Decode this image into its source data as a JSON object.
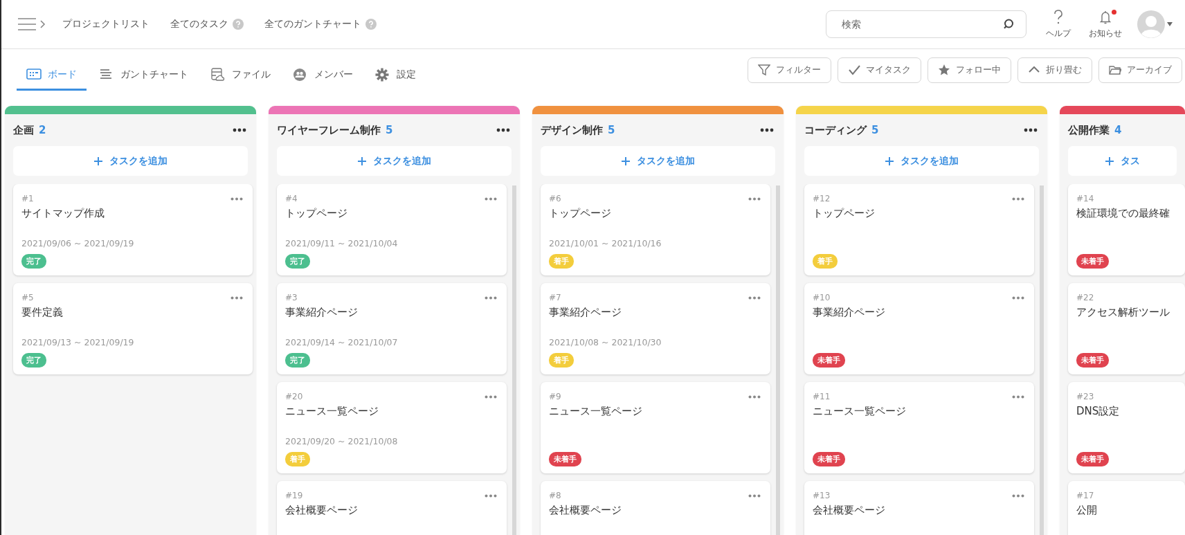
{
  "topbar": {
    "links": [
      {
        "label": "プロジェクトリスト",
        "help": false
      },
      {
        "label": "全てのタスク",
        "help": true
      },
      {
        "label": "全てのガントチャート",
        "help": true
      }
    ],
    "search": {
      "placeholder": "検索"
    },
    "help": {
      "label": "ヘルプ"
    },
    "notifications": {
      "label": "お知らせ",
      "unread": true
    }
  },
  "tabs": [
    {
      "label": "ボード",
      "selected": true
    },
    {
      "label": "ガントチャート",
      "selected": false
    },
    {
      "label": "ファイル",
      "selected": false
    },
    {
      "label": "メンバー",
      "selected": false
    },
    {
      "label": "設定",
      "selected": false
    }
  ],
  "actions": [
    "フィルター",
    "マイタスク",
    "フォロー中",
    "折り畳む",
    "アーカイブ"
  ],
  "columns": [
    {
      "title": "企画",
      "count": "2",
      "color": "#52c08e",
      "menu": true,
      "add_label": "タスクを追加",
      "cards": [
        {
          "id": "#1",
          "title": "サイトマップ作成",
          "dates": "2021/09/06 ~ 2021/09/19",
          "status": {
            "label": "完了",
            "color": "#4cbf8f"
          }
        },
        {
          "id": "#5",
          "title": "要件定義",
          "dates": "2021/09/13 ~ 2021/09/19",
          "status": {
            "label": "完了",
            "color": "#4cbf8f"
          }
        }
      ]
    },
    {
      "title": "ワイヤーフレーム制作",
      "count": "5",
      "color": "#ec74b5",
      "menu": true,
      "add_label": "タスクを追加",
      "cards": [
        {
          "id": "#4",
          "title": "トップページ",
          "dates": "2021/09/11 ~ 2021/10/04",
          "status": {
            "label": "完了",
            "color": "#4cbf8f"
          }
        },
        {
          "id": "#3",
          "title": "事業紹介ページ",
          "dates": "2021/09/14 ~ 2021/10/07",
          "status": {
            "label": "完了",
            "color": "#4cbf8f"
          }
        },
        {
          "id": "#20",
          "title": "ニュース一覧ページ",
          "dates": "2021/09/20 ~ 2021/10/08",
          "status": {
            "label": "着手",
            "color": "#f3cd3c"
          }
        },
        {
          "id": "#19",
          "title": "会社概要ページ"
        }
      ]
    },
    {
      "title": "デザイン制作",
      "count": "5",
      "color": "#f0913f",
      "menu": true,
      "add_label": "タスクを追加",
      "cards": [
        {
          "id": "#6",
          "title": "トップページ",
          "dates": "2021/10/01 ~ 2021/10/16",
          "status": {
            "label": "着手",
            "color": "#f3cd3c"
          }
        },
        {
          "id": "#7",
          "title": "事業紹介ページ",
          "dates": "2021/10/08 ~ 2021/10/30",
          "status": {
            "label": "着手",
            "color": "#f3cd3c"
          }
        },
        {
          "id": "#9",
          "title": "ニュース一覧ページ",
          "status": {
            "label": "未着手",
            "color": "#e0434f"
          }
        },
        {
          "id": "#8",
          "title": "会社概要ページ"
        }
      ]
    },
    {
      "title": "コーディング",
      "count": "5",
      "color": "#f5d44a",
      "menu": true,
      "add_label": "タスクを追加",
      "cards": [
        {
          "id": "#12",
          "title": "トップページ",
          "status": {
            "label": "着手",
            "color": "#f3cd3c"
          }
        },
        {
          "id": "#10",
          "title": "事業紹介ページ",
          "status": {
            "label": "未着手",
            "color": "#e0434f"
          }
        },
        {
          "id": "#11",
          "title": "ニュース一覧ページ",
          "status": {
            "label": "未着手",
            "color": "#e0434f"
          }
        },
        {
          "id": "#13",
          "title": "会社概要ページ"
        }
      ]
    },
    {
      "title": "公開作業",
      "count": "4",
      "color": "#e5485a",
      "menu": false,
      "add_label": "タス",
      "cards": [
        {
          "id": "#14",
          "title": "検証環境での最終確",
          "status": {
            "label": "未着手",
            "color": "#e0434f"
          }
        },
        {
          "id": "#22",
          "title": "アクセス解析ツール",
          "status": {
            "label": "未着手",
            "color": "#e0434f"
          }
        },
        {
          "id": "#23",
          "title": "DNS設定",
          "status": {
            "label": "未着手",
            "color": "#e0434f"
          }
        },
        {
          "id": "#17",
          "title": "公開"
        }
      ]
    }
  ]
}
